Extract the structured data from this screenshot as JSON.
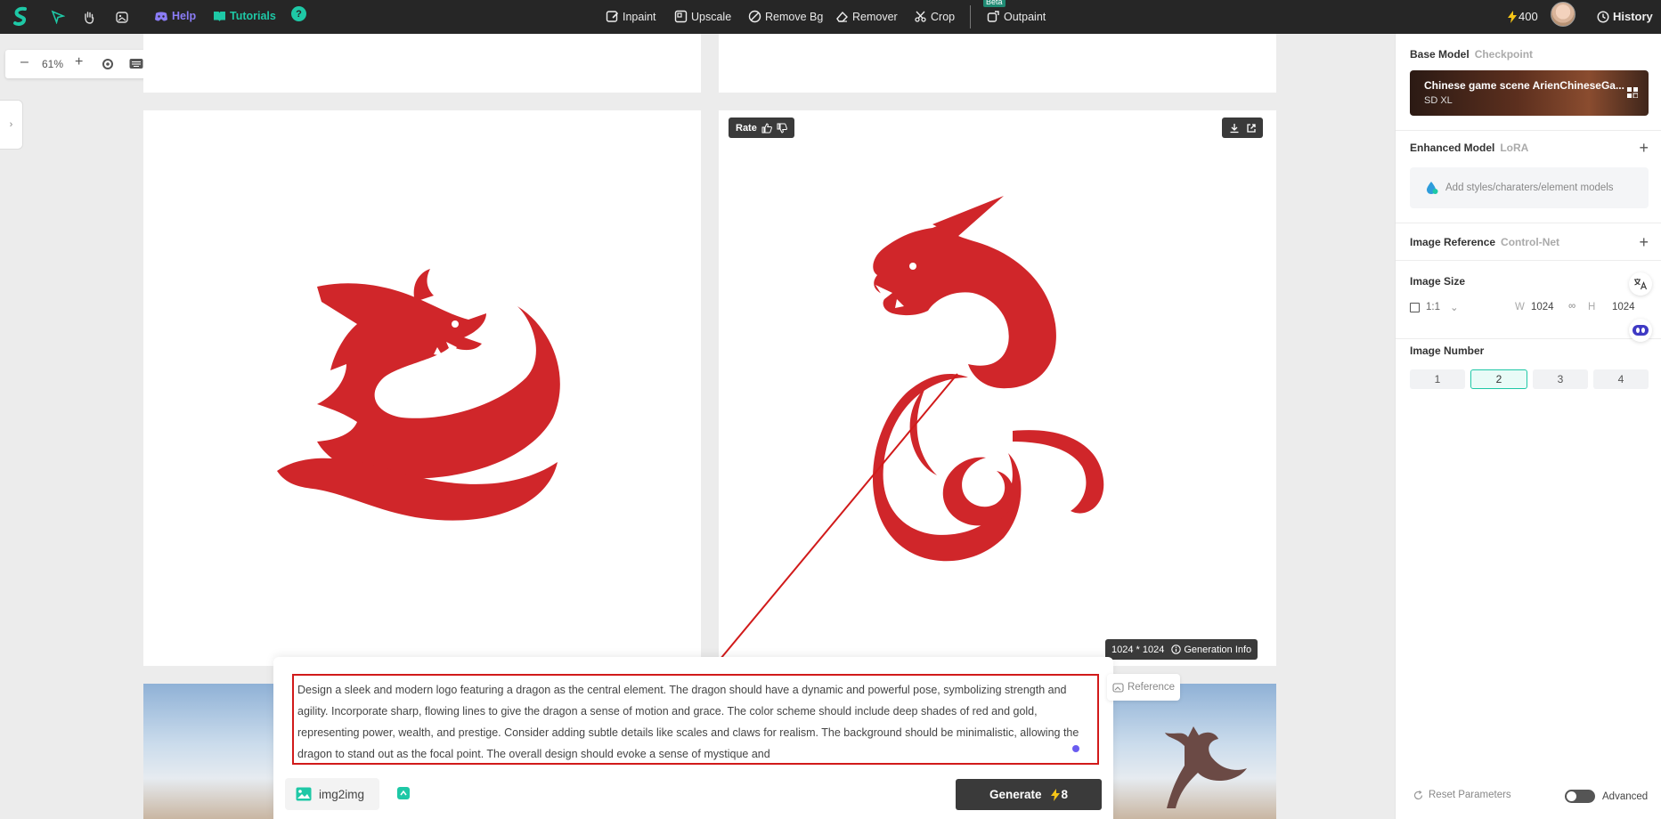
{
  "topbar": {
    "help": "Help",
    "tutorials": "Tutorials",
    "question": "?",
    "tools": [
      "Inpaint",
      "Upscale",
      "Remove Bg",
      "Remover",
      "Crop",
      "Outpaint"
    ],
    "beta": "Beta",
    "credits": "400",
    "history": "History"
  },
  "canvas": {
    "zoom": "61%",
    "rate": "Rate",
    "size_label": "1024 * 1024",
    "generation_info": "Generation Info"
  },
  "prompt": {
    "text": "Design a sleek and modern logo featuring a dragon as the central element. The dragon should have a dynamic and powerful pose, symbolizing strength and agility. Incorporate sharp, flowing lines to give the dragon a sense of motion and grace. The color scheme should include deep shades of red and gold, representing power, wealth, and prestige. Consider adding subtle details like scales and claws for realism. The background should be minimalistic, allowing the dragon to stand out as the focal point. The overall design should evoke a sense of mystique and",
    "reference": "Reference",
    "img2img": "img2img",
    "generate": "Generate",
    "generate_cost": "8"
  },
  "panel": {
    "base_model": "Base Model",
    "checkpoint": "Checkpoint",
    "model_name": "Chinese game scene ArienChineseGa...",
    "model_type": "SD XL",
    "enhanced_model": "Enhanced Model",
    "lora": "LoRA",
    "lora_placeholder": "Add styles/charaters/element models",
    "image_reference": "Image Reference",
    "control_net": "Control-Net",
    "image_size": "Image Size",
    "ratio": "1:1",
    "w_label": "W",
    "w_value": "1024",
    "h_label": "H",
    "h_value": "1024",
    "image_number": "Image Number",
    "numbers": [
      "1",
      "2",
      "3",
      "4"
    ],
    "selected_number": "2",
    "reset": "Reset Parameters",
    "advanced": "Advanced"
  },
  "colors": {
    "topbar_bg": "#262626",
    "accent_green": "#1ec8a6",
    "discord_purple": "#8b7cf6",
    "dragon_red": "#d0262a",
    "annotation_red": "#d11a1a",
    "credit_yellow": "#f5c518"
  },
  "icons": [
    "logo-icon",
    "select-arrow-icon",
    "hand-icon",
    "image-edit-icon",
    "discord-icon",
    "book-icon",
    "question-icon",
    "inpaint-icon",
    "upscale-icon",
    "remove-bg-icon",
    "eraser-icon",
    "crop-icon",
    "outpaint-icon",
    "lightning-icon",
    "clock-icon",
    "minus-icon",
    "plus-icon",
    "target-icon",
    "keyboard-icon",
    "thumbs-up-icon",
    "thumbs-down-icon",
    "download-icon",
    "external-link-icon",
    "info-icon",
    "grid-icon",
    "droplet-icon",
    "translate-icon",
    "robot-icon",
    "reset-icon"
  ]
}
